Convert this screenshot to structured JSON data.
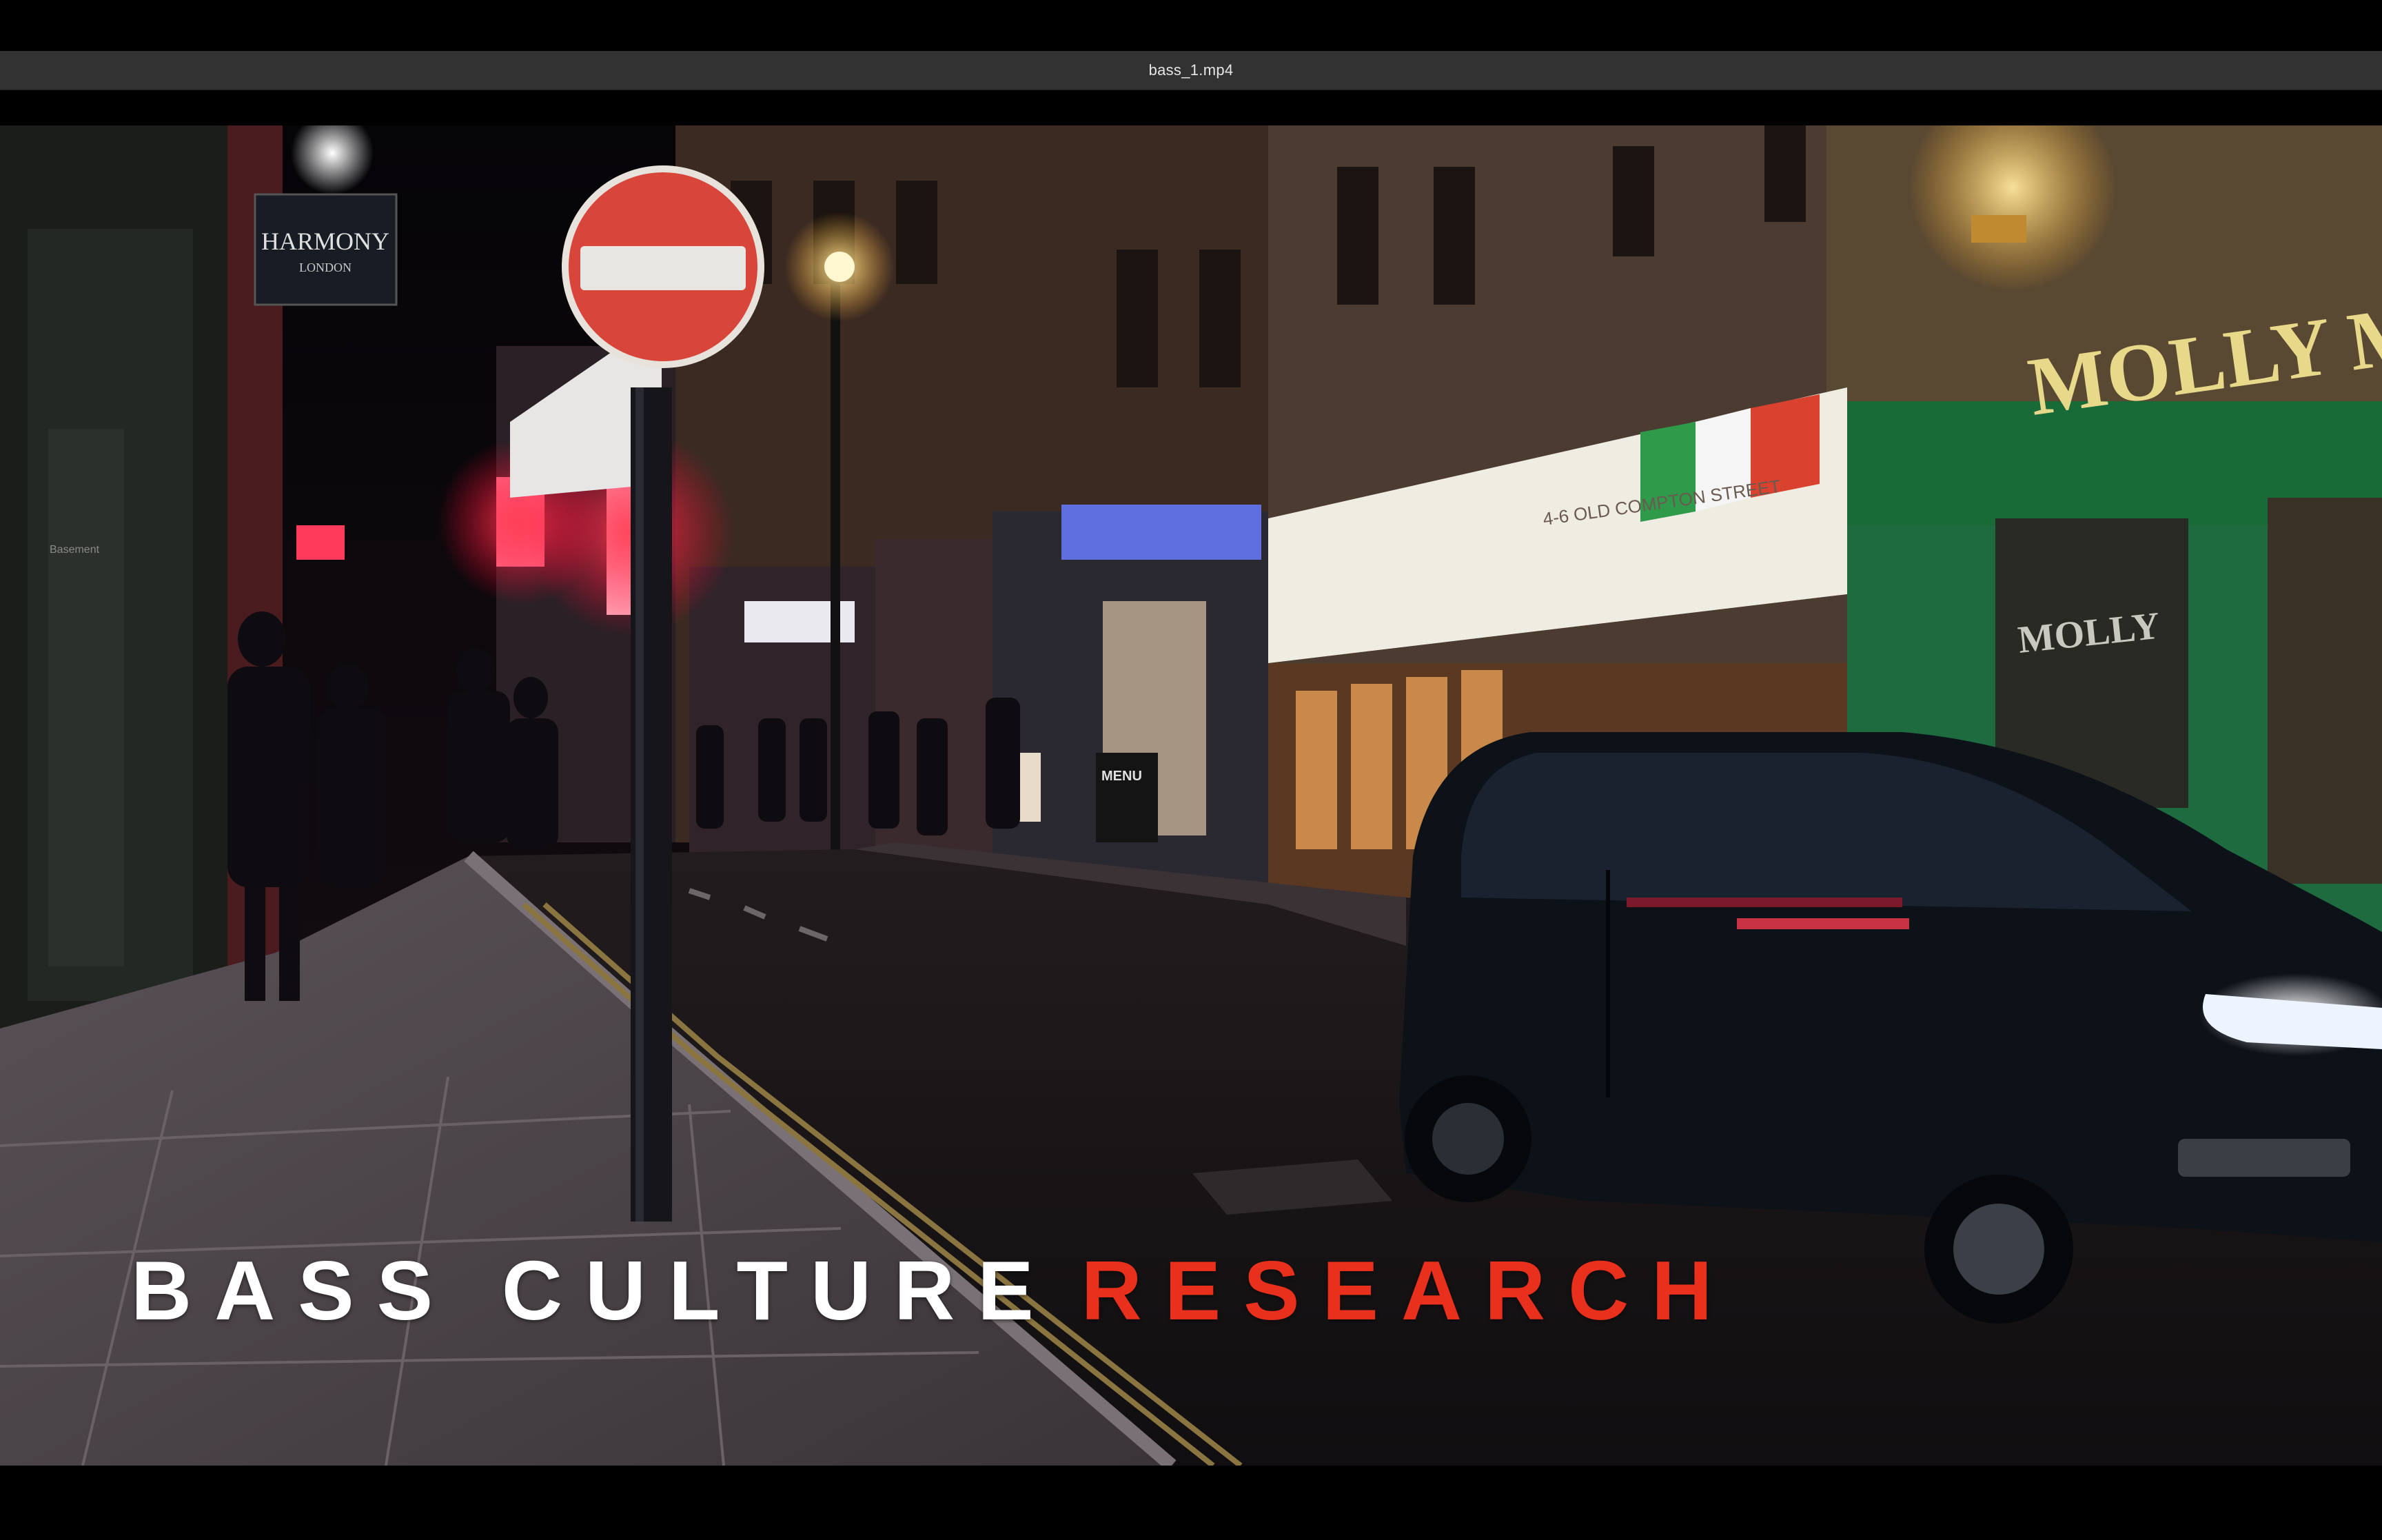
{
  "window": {
    "title": "bass_1.mp4"
  },
  "video": {
    "caption": {
      "word1": "BASS CULTURE",
      "word2": "RESEARCH",
      "word1_color": "#ffffff",
      "word2_color": "#e8301c"
    },
    "signs": {
      "shop_sign_top": "HARMONY",
      "shop_sign_bottom": "LONDON",
      "pub_sign": "MOLLY MO",
      "pub_window": "MOLLY",
      "restaurant_address": "4-6 OLD COMPTON STREET",
      "menu_board": "MENU"
    }
  }
}
